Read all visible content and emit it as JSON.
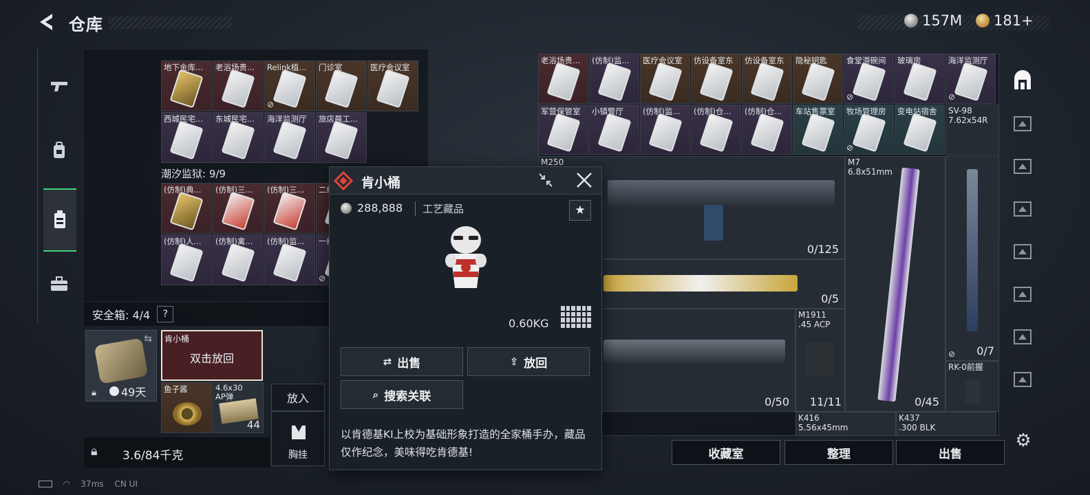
{
  "header": {
    "title": "仓库"
  },
  "currency": {
    "silver": "157M",
    "gold": "181+"
  },
  "left_nav": [
    {
      "icon": "pistol-icon"
    },
    {
      "icon": "backpack-icon"
    },
    {
      "icon": "vest-icon",
      "active": true
    },
    {
      "icon": "briefcase-icon"
    }
  ],
  "stash": {
    "row1": [
      {
        "label": "地下金库...",
        "color": "red",
        "card": "gold"
      },
      {
        "label": "老浴场贵...",
        "color": "red",
        "card": "normal"
      },
      {
        "label": "Relink植...",
        "color": "orange",
        "card": "normal",
        "flag": true
      },
      {
        "label": "门诊室",
        "color": "orange",
        "card": "normal"
      },
      {
        "label": "医疗会议室",
        "color": "orange",
        "card": "normal"
      }
    ],
    "row2": [
      {
        "label": "西城民宅...",
        "color": "purple",
        "card": "normal"
      },
      {
        "label": "东城民宅...",
        "color": "purple",
        "card": "normal"
      },
      {
        "label": "海洋监测厅",
        "color": "purple",
        "card": "normal"
      },
      {
        "label": "旅店晨工...",
        "color": "purple",
        "card": "normal"
      }
    ],
    "section2_label": "潮汐监狱: 9/9",
    "row3": [
      {
        "label": "(仿制)典...",
        "color": "red",
        "card": "gold"
      },
      {
        "label": "(仿制)三...",
        "color": "red",
        "card": "red"
      },
      {
        "label": "(仿制)三...",
        "color": "red",
        "card": "red"
      },
      {
        "label": "二级...",
        "color": "red",
        "card": "normal"
      }
    ],
    "row4": [
      {
        "label": "(仿制)人...",
        "color": "purple",
        "card": "normal"
      },
      {
        "label": "(仿制)禽...",
        "color": "purple",
        "card": "normal"
      },
      {
        "label": "(仿制)监...",
        "color": "purple",
        "card": "normal"
      },
      {
        "label": "一级...",
        "color": "purple",
        "card": "normal",
        "flag": true
      }
    ]
  },
  "safe_box": {
    "label": "安全箱: 4/4",
    "help": "?",
    "days": "49天",
    "bucket_name": "肯小桶",
    "bucket_action": "双击放回",
    "caviar_name": "鱼子酱",
    "ammo_name": "4.6x30\nAP弹",
    "ammo_count": "44"
  },
  "put_in": {
    "label": "放入"
  },
  "vest": {
    "label": "胸挂"
  },
  "weight": {
    "value": "3.6/84千克"
  },
  "storage": {
    "row1": [
      {
        "label": "老浴场贵...",
        "color": "red"
      },
      {
        "label": "(仿制)监...",
        "color": "purple"
      },
      {
        "label": "医疗会议室",
        "color": "orange"
      },
      {
        "label": "仿设备室东",
        "color": "orange"
      },
      {
        "label": "仿设备室东",
        "color": "orange"
      },
      {
        "label": "隐秘钥匙",
        "color": "orange"
      },
      {
        "label": "食堂滞碗间",
        "color": "purple",
        "flag": true
      },
      {
        "label": "玻璃房",
        "color": "purple"
      },
      {
        "label": "海洋监测厅",
        "color": "purple",
        "flag": true
      }
    ],
    "row2": [
      {
        "label": "军营保管室",
        "color": "purple"
      },
      {
        "label": "小镇警厅",
        "color": "purple"
      },
      {
        "label": "(仿制)监...",
        "color": "purple"
      },
      {
        "label": "(仿制)仓...",
        "color": "purple"
      },
      {
        "label": "(仿制)仓...",
        "color": "purple"
      },
      {
        "label": "车站售票室",
        "color": "teal"
      },
      {
        "label": "牧场管理房",
        "color": "teal",
        "flag": true
      },
      {
        "label": "变电站宿舍",
        "color": "teal"
      }
    ],
    "sv98": {
      "name": "SV-98\n7.62x54R"
    },
    "m250": {
      "name": "M250",
      "count": "0/125"
    },
    "m7": {
      "name": "M7\n6.8x51mm",
      "count": "0/45"
    },
    "sniper_count": "0/5",
    "mg_count": "0/50",
    "m1911": {
      "name": "M1911\n.45 ACP",
      "count": "11/11"
    },
    "sv98_count": "0/7",
    "rk0": {
      "name": "RK-0前握"
    },
    "k416": {
      "name": "K416\n5.56x45mm"
    },
    "k437": {
      "name": "K437\n.300 BLK"
    }
  },
  "right_bar": [
    {
      "icon": "storage-icon",
      "active": true
    },
    {
      "icon": "tab-i-icon"
    },
    {
      "icon": "tab-ii-icon"
    },
    {
      "icon": "tab-iii-icon"
    },
    {
      "icon": "tab-iii-icon"
    },
    {
      "icon": "tab-iii-icon"
    },
    {
      "icon": "tab-iv-icon"
    },
    {
      "icon": "tab-iv-icon"
    }
  ],
  "bottom_buttons": {
    "collection": "收藏室",
    "organize": "整理",
    "sell": "出售"
  },
  "popup": {
    "title": "肯小桶",
    "price": "288,888",
    "type": "工艺藏品",
    "weight": "0.60KG",
    "sell_label": "出售",
    "return_label": "放回",
    "search_label": "搜索关联",
    "description": "以肯德基KI上校为基础形象打造的全家桶手办，藏品仅作纪念，美味得吃肯德基!"
  },
  "status": {
    "ping": "37ms",
    "region": "CN UI"
  }
}
